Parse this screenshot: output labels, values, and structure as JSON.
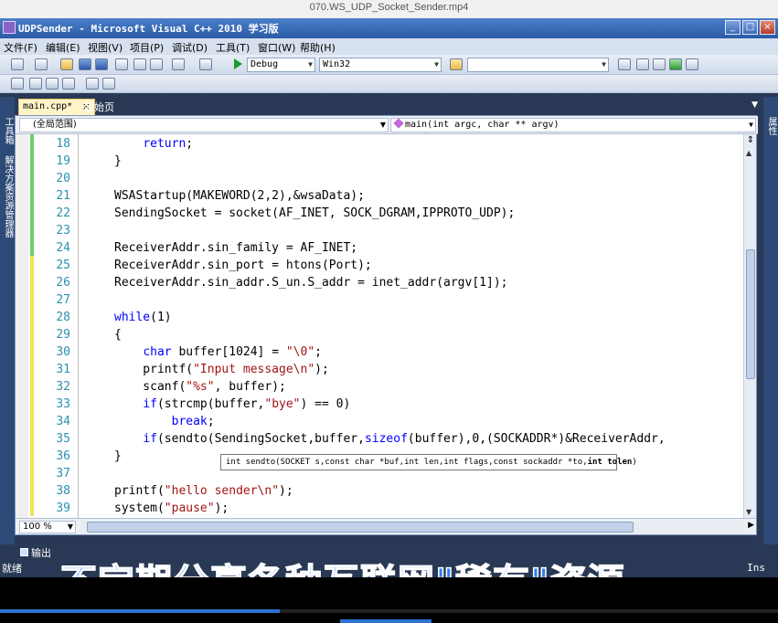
{
  "player": {
    "filename": "070.WS_UDP_Socket_Sender.mp4",
    "progress": 0.36,
    "subtitle": "不定期分享各种互联网\"稀有\"资源"
  },
  "window": {
    "title": "UDPSender - Microsoft Visual C++ 2010 学习版",
    "buttons": [
      "_",
      "□",
      "×"
    ]
  },
  "menu": [
    "文件(F)",
    "编辑(E)",
    "视图(V)",
    "项目(P)",
    "调试(D)",
    "工具(T)",
    "窗口(W)",
    "帮助(H)"
  ],
  "toolbar": {
    "config": "Debug",
    "platform": "Win32",
    "find_value": ""
  },
  "side_tabs": {
    "left": [
      "工具箱",
      "解决方案资源管理器"
    ],
    "right": [
      "属性"
    ]
  },
  "tabs": {
    "active": "main.cpp*",
    "inactive": "起始页",
    "close": "×",
    "dropdown": "▼"
  },
  "navbar": {
    "scope": "(全局范围)",
    "member": "main(int argc, char ** argv)"
  },
  "code_lines": [
    {
      "n": "18",
      "text": "        return;"
    },
    {
      "n": "19",
      "text": "    }"
    },
    {
      "n": "20",
      "text": ""
    },
    {
      "n": "21",
      "text": "    WSAStartup(MAKEWORD(2,2),&wsaData);"
    },
    {
      "n": "22",
      "text": "    SendingSocket = socket(AF_INET, SOCK_DGRAM,IPPROTO_UDP);"
    },
    {
      "n": "23",
      "text": ""
    },
    {
      "n": "24",
      "text": "    ReceiverAddr.sin_family = AF_INET;"
    },
    {
      "n": "25",
      "text": "    ReceiverAddr.sin_port = htons(Port);"
    },
    {
      "n": "26",
      "text": "    ReceiverAddr.sin_addr.S_un.S_addr = inet_addr(argv[1]);"
    },
    {
      "n": "27",
      "text": ""
    },
    {
      "n": "28",
      "text": "    while(1)"
    },
    {
      "n": "29",
      "text": "    {"
    },
    {
      "n": "30",
      "text": "        char buffer[1024] = \"\\0\";"
    },
    {
      "n": "31",
      "text": "        printf(\"Input message\\n\");"
    },
    {
      "n": "32",
      "text": "        scanf(\"%s\", buffer);"
    },
    {
      "n": "33",
      "text": "        if(strcmp(buffer,\"bye\") == 0)"
    },
    {
      "n": "34",
      "text": "            break;"
    },
    {
      "n": "35",
      "text": "        if(sendto(SendingSocket,buffer,sizeof(buffer),0,(SOCKADDR*)&ReceiverAddr,"
    },
    {
      "n": "36",
      "text": "    }"
    },
    {
      "n": "37",
      "text": ""
    },
    {
      "n": "38",
      "text": "    printf(\"hello sender\\n\");"
    },
    {
      "n": "39",
      "text": "    system(\"pause\");"
    }
  ],
  "tooltip": {
    "prefix": "int sendto(SOCKET s,const char *buf,int len,int flags,const sockaddr *to,",
    "current_param": "int tolen",
    "suffix": ")"
  },
  "zoom": "100 %",
  "output_tab": "输出",
  "status": {
    "left": "就绪",
    "mode": "Ins"
  },
  "colors": {
    "keyword": "#0000ff",
    "string": "#a31515",
    "line_number": "#2b91af",
    "ide_frame": "#293955",
    "subtitle": "#2f7df0"
  }
}
